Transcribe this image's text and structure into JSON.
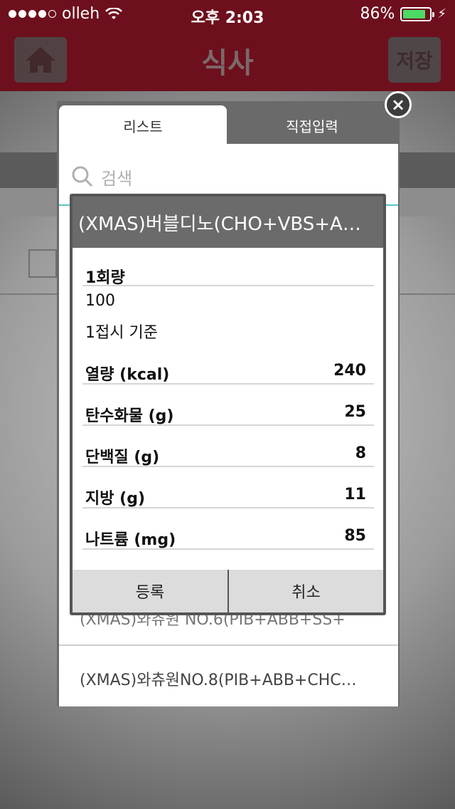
{
  "status_bar": {
    "carrier": "olleh",
    "time": "오후 2:03",
    "battery": "86%",
    "battery_level": 0.86
  },
  "nav": {
    "title": "식사",
    "save_label": "저장",
    "icons": {
      "home": "home-icon"
    }
  },
  "tabs": [
    {
      "label": "리스트",
      "active": true
    },
    {
      "label": "직접입력",
      "active": false
    }
  ],
  "search": {
    "placeholder": "검색"
  },
  "list_items": [
    "(XMAS)와츄원 NO.6(PIB+ABB+SS+",
    "(XMAS)와츄원NO.8(PIB+ABB+CHC…"
  ],
  "dialog": {
    "title": "(XMAS)버블디노(CHO+VBS+A…",
    "serving_label": "1회량",
    "serving_amount": "100",
    "serving_basis": "1접시 기준",
    "nutrients": [
      {
        "label": "열량 (kcal)",
        "value": "240"
      },
      {
        "label": "탄수화물 (g)",
        "value": "25"
      },
      {
        "label": "단백질 (g)",
        "value": "8"
      },
      {
        "label": "지방 (g)",
        "value": "11"
      },
      {
        "label": "나트륨 (mg)",
        "value": "85"
      }
    ],
    "register_label": "등록",
    "cancel_label": "취소"
  },
  "colors": {
    "brand": "#6e0f1d",
    "accent": "#5bc7c2",
    "button_green": "#3a6b63"
  }
}
